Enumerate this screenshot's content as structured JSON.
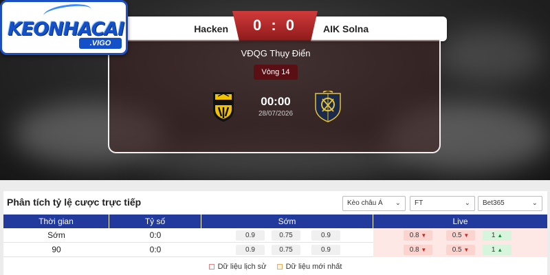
{
  "logo": {
    "text": "KEONHACAI",
    "sub": ".VIGO"
  },
  "match": {
    "home_team": "Hacken",
    "away_team": "AIK Solna",
    "score": "0 : 0",
    "league": "VĐQG Thụy Điển",
    "round": "Vòng 14",
    "time": "00:00",
    "date": "28/07/2026",
    "home_crest_text": "HACKEN",
    "away_crest_text": "AIK"
  },
  "odds_panel": {
    "title": "Phân tích tỷ lệ cược trực tiếp",
    "selects": {
      "market": "Kèo châu Á",
      "period": "FT",
      "bookmaker": "Bet365"
    },
    "headers": [
      "Thời gian",
      "Tỷ số",
      "Sớm",
      "Live"
    ],
    "rows": [
      {
        "time": "Sớm",
        "score": "0:0",
        "early": [
          "0.9",
          "0.75",
          "0.9"
        ],
        "live": [
          "0.8",
          "0.5",
          "1"
        ]
      },
      {
        "time": "90",
        "score": "0:0",
        "early": [
          "0.9",
          "0.75",
          "0.9"
        ],
        "live": [
          "0.8",
          "0.5",
          "1"
        ]
      }
    ],
    "legend": {
      "history": "Dữ liệu lịch sử",
      "latest": "Dữ liệu mới nhất"
    }
  },
  "colors": {
    "header_blue": "#213a9c",
    "score_red": "#b52a2a",
    "round_bg": "#5a0f14"
  },
  "icons": {
    "dropdown": "chevron-down-icon",
    "odds_down": "arrow-down-icon",
    "odds_up": "arrow-up-icon"
  }
}
